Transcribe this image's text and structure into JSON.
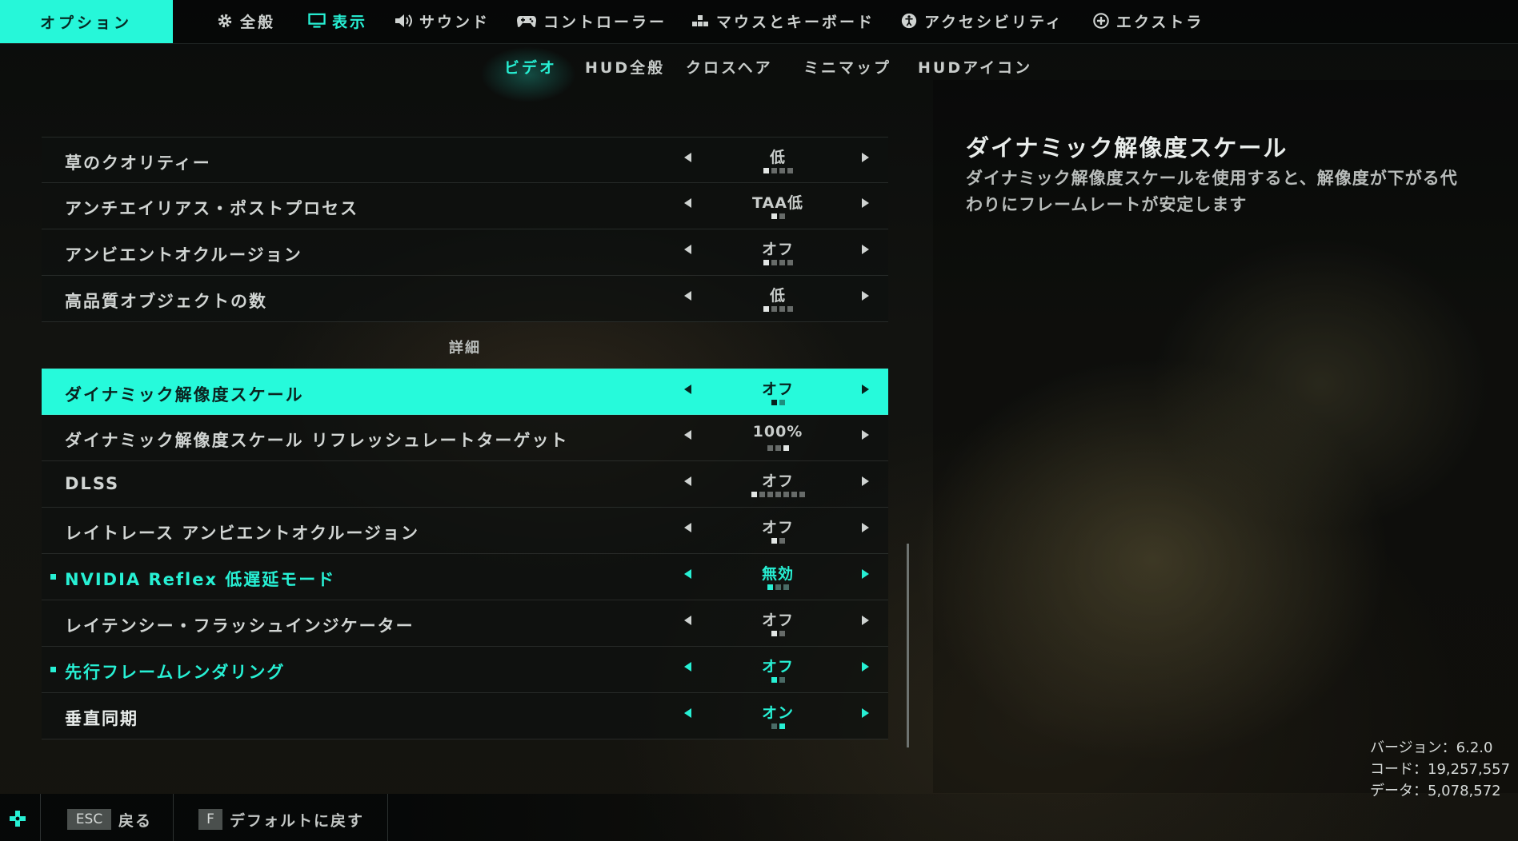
{
  "header": {
    "options_label": "オプション",
    "tabs": [
      {
        "label": "全般",
        "icon": "gear-icon"
      },
      {
        "label": "表示",
        "icon": "monitor-icon",
        "active": true
      },
      {
        "label": "サウンド",
        "icon": "speaker-icon"
      },
      {
        "label": "コントローラー",
        "icon": "gamepad-icon"
      },
      {
        "label": "マウスとキーボード",
        "icon": "keyboard-icon"
      },
      {
        "label": "アクセシビリティ",
        "icon": "accessibility-icon"
      },
      {
        "label": "エクストラ",
        "icon": "plus-circle-icon"
      }
    ]
  },
  "subtabs": [
    {
      "label": "ビデオ",
      "active": true
    },
    {
      "label": "HUD全般"
    },
    {
      "label": "クロスヘア"
    },
    {
      "label": "ミニマップ"
    },
    {
      "label": "HUDアイコン"
    }
  ],
  "settings": [
    {
      "label": "草のクオリティー",
      "value": "低",
      "pips": 4,
      "pip_on": 1
    },
    {
      "label": "アンチエイリアス・ポストプロセス",
      "value": "TAA低",
      "pips": 2,
      "pip_on": 1
    },
    {
      "label": "アンビエントオクルージョン",
      "value": "オフ",
      "pips": 4,
      "pip_on": 1
    },
    {
      "label": "高品質オブジェクトの数",
      "value": "低",
      "pips": 4,
      "pip_on": 1
    }
  ],
  "section_label": "詳細",
  "advanced": [
    {
      "label": "ダイナミック解像度スケール",
      "value": "オフ",
      "pips": 2,
      "pip_on": 1,
      "selected": true
    },
    {
      "label": "ダイナミック解像度スケール リフレッシュレートターゲット",
      "value": "100%",
      "pips": 3,
      "pip_on": 3
    },
    {
      "label": "DLSS",
      "value": "オフ",
      "pips": 7,
      "pip_on": 1
    },
    {
      "label": "レイトレース アンビエントオクルージョン",
      "value": "オフ",
      "pips": 2,
      "pip_on": 1
    },
    {
      "label": "NVIDIA Reflex 低遅延モード",
      "value": "無効",
      "pips": 3,
      "pip_on": 1,
      "accent": true
    },
    {
      "label": "レイテンシー・フラッシュインジケーター",
      "value": "オフ",
      "pips": 2,
      "pip_on": 1
    },
    {
      "label": "先行フレームレンダリング",
      "value": "オフ",
      "pips": 2,
      "pip_on": 1,
      "accent": true
    },
    {
      "label": "垂直同期",
      "value": "オン",
      "pips": 2,
      "pip_on": 2
    }
  ],
  "description": {
    "title": "ダイナミック解像度スケール",
    "text": "ダイナミック解像度スケールを使用すると、解像度が下がる代わりにフレームレートが安定します"
  },
  "version_info": {
    "version": "バージョン：6.2.0",
    "code": "コード：19,257,557",
    "data": "データ：5,078,572"
  },
  "footer": {
    "esc_key": "ESC",
    "back_label": "戻る",
    "f_key": "F",
    "default_label": "デフォルトに戻す"
  },
  "colors": {
    "accent": "#26f7d9",
    "background": "#0d0f0d"
  }
}
